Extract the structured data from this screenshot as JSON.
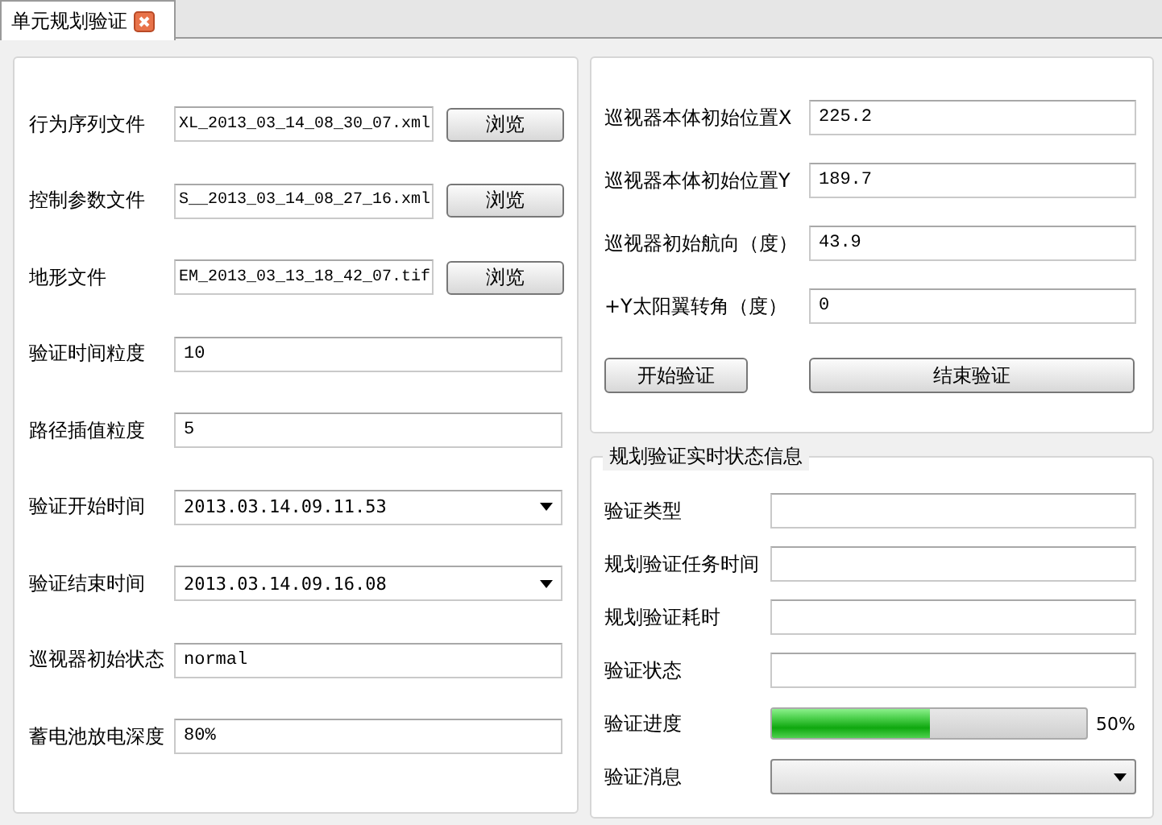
{
  "tabs": [
    {
      "label": "单元规划验证",
      "selected": true,
      "closable": true
    }
  ],
  "settings": {
    "rows": [
      {
        "kind": "file",
        "label": "行为序列文件",
        "value": "XL_2013_03_14_08_30_07.xml",
        "button": "浏览"
      },
      {
        "kind": "file",
        "label": "控制参数文件",
        "value": "S__2013_03_14_08_27_16.xml",
        "button": "浏览"
      },
      {
        "kind": "file",
        "label": "地形文件",
        "value": "EM_2013_03_13_18_42_07.tif",
        "button": "浏览"
      },
      {
        "kind": "text",
        "label": "验证时间粒度",
        "value": "10"
      },
      {
        "kind": "text",
        "label": "路径插值粒度",
        "value": "5"
      },
      {
        "kind": "combo",
        "label": "验证开始时间",
        "value": "2013.03.14.09.11.53"
      },
      {
        "kind": "combo",
        "label": "验证结束时间",
        "value": "2013.03.14.09.16.08"
      },
      {
        "kind": "text",
        "label": "巡视器初始状态",
        "value": "normal"
      },
      {
        "kind": "text",
        "label": "蓄电池放电深度",
        "value": "80%"
      }
    ]
  },
  "initial": {
    "rows": [
      {
        "kind": "text",
        "label": "巡视器本体初始位置X",
        "value": "225.2"
      },
      {
        "kind": "text",
        "label": "巡视器本体初始位置Y",
        "value": "189.7"
      },
      {
        "kind": "text",
        "label": "巡视器初始航向（度）",
        "value": "43.9"
      },
      {
        "kind": "text",
        "label": "+Y太阳翼转角（度）",
        "value": "0"
      }
    ],
    "buttons": [
      "开始验证",
      "结束验证"
    ]
  },
  "status": {
    "title": "规划验证实时状态信息",
    "rows": [
      {
        "kind": "text",
        "label": "验证类型"
      },
      {
        "kind": "text",
        "label": "规划验证任务时间"
      },
      {
        "kind": "text",
        "label": "规划验证耗时"
      },
      {
        "kind": "text",
        "label": "验证状态"
      },
      {
        "kind": "progress",
        "label": "验证进度",
        "level": 0.5,
        "reading": "50%"
      },
      {
        "kind": "combo",
        "label": "验证消息"
      }
    ]
  }
}
